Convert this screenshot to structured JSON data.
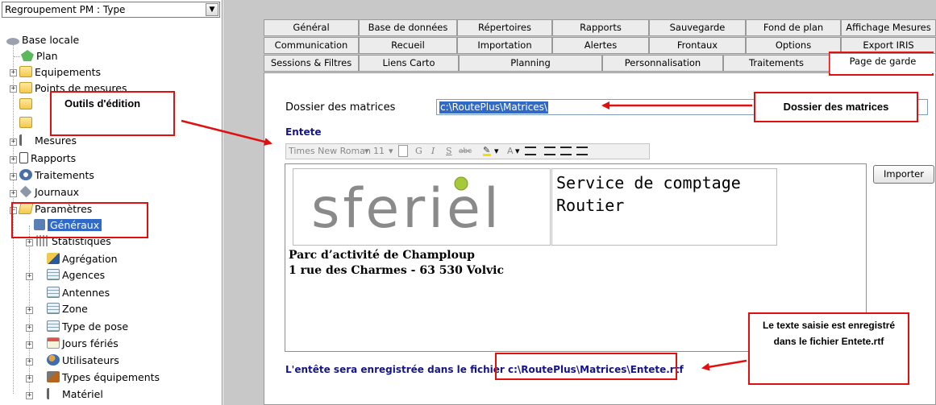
{
  "tree": {
    "combo_label": "Regroupement PM : Type",
    "items": [
      {
        "label": "Base locale",
        "icon": "database-icon"
      },
      {
        "label": "Plan",
        "icon": "map-icon"
      },
      {
        "label": "Equipements",
        "icon": "folder-icon"
      },
      {
        "label": "Points de mesures",
        "icon": "folder-icon"
      },
      {
        "label": "",
        "icon": "folder-icon"
      },
      {
        "label": "",
        "icon": "folder-icon"
      },
      {
        "label": "Mesures",
        "icon": "measures-icon"
      },
      {
        "label": "Rapports",
        "icon": "report-icon"
      },
      {
        "label": "Traitements",
        "icon": "gear-icon"
      },
      {
        "label": "Journaux",
        "icon": "journal-icon"
      },
      {
        "label": "Paramètres",
        "icon": "folder-open-icon"
      },
      {
        "label": "Généraux",
        "icon": "settings-icon"
      },
      {
        "label": "Statistiques",
        "icon": "stats-icon"
      },
      {
        "label": "Agrégation",
        "icon": "aggregation-icon"
      },
      {
        "label": "Agences",
        "icon": "grid-icon"
      },
      {
        "label": "Antennes",
        "icon": "grid-icon"
      },
      {
        "label": "Zone",
        "icon": "grid-icon"
      },
      {
        "label": "Type de pose",
        "icon": "grid-icon"
      },
      {
        "label": "Jours fériés",
        "icon": "calendar-icon"
      },
      {
        "label": "Utilisateurs",
        "icon": "users-icon"
      },
      {
        "label": "Types équipements",
        "icon": "equipment-icon"
      },
      {
        "label": "Matériel",
        "icon": "hardware-icon"
      }
    ]
  },
  "tabs": {
    "row1": [
      "Général",
      "Base de données",
      "Répertoires",
      "Rapports",
      "Sauvegarde",
      "Fond de plan",
      "Affichage Mesures"
    ],
    "row2": [
      "Communication",
      "Recueil",
      "Importation",
      "Alertes",
      "Frontaux",
      "Options",
      "Export IRIS"
    ],
    "row3": [
      "Sessions & Filtres",
      "Liens Carto",
      "Planning",
      "Personnalisation",
      "Traitements",
      "Page de garde"
    ]
  },
  "page": {
    "matrix_label": "Dossier des matrices",
    "matrix_value": "c:\\RoutePlus\\Matrices\\",
    "entete_label": "Entete",
    "toolbar": {
      "font": "Times New Roman",
      "size": "11",
      "bold": "G",
      "italic": "I",
      "underline": "S",
      "strike": "abc",
      "color": "A"
    },
    "logo_text": "sferiel",
    "service_text": "Service de comptage Routier",
    "address_line1": "Parc d’activité de Champloup",
    "address_line2": "1 rue des Charmes - 63 530 Volvic",
    "import_label": "Importer",
    "footer_text": "L'entête sera enregistrée dans le fichier c:\\RoutePlus\\Matrices\\Entete.rtf"
  },
  "annotations": {
    "outils": "Outils d'édition",
    "dossier": "Dossier des matrices",
    "texte": "Le texte saisie est enregistré dans le fichier Entete.rtf"
  },
  "colors": {
    "annotation_red": "#e01010",
    "selection_blue": "#3169c6",
    "label_navy": "#15158a"
  }
}
